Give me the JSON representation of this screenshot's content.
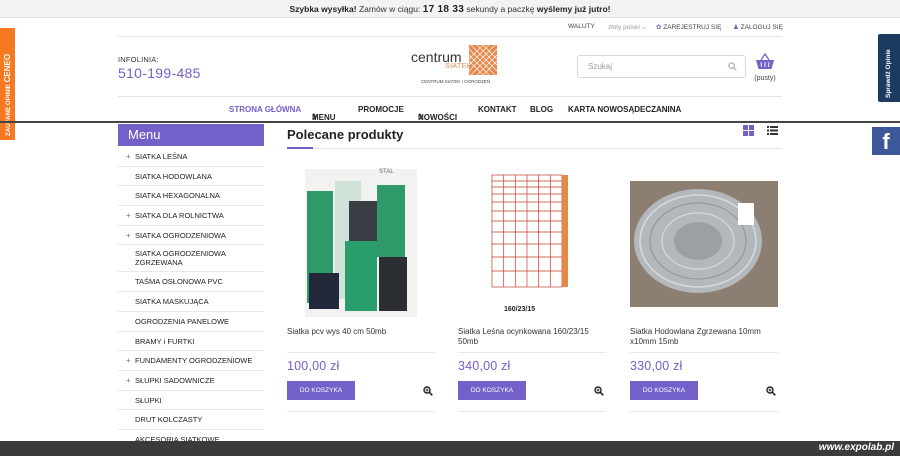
{
  "topbar": {
    "lead": "Szybka wysyłka!",
    "before": " Zamów w ciągu: ",
    "timer": "17 18 33",
    "middle": " sekundy  a paczkę ",
    "strong_end": "wyślemy już jutro!"
  },
  "account": {
    "currency": "WALUTY",
    "currency_value": "złoty polski",
    "register": "ZAREJESTRUJ SIĘ",
    "login": "ZALOGUJ SIĘ"
  },
  "side_badges": {
    "ceneo_text": "ZAUFANE OPINIE",
    "ceneo_brand": "CENEO",
    "sprawdz": "Sprawdź Opinie",
    "facebook": "f"
  },
  "header": {
    "infolinia_label": "INFOLINIA:",
    "phone": "510-199-485",
    "logo_top": "centrum",
    "logo_bottom": "SIATEK",
    "logo_tagline": "CENTRUM SIATEK I OGRODZEŃ",
    "search_placeholder": "Szukaj",
    "cart_count": "(pusty)"
  },
  "nav": {
    "items": [
      "STRONA GŁÓWNA",
      "MENU",
      "PROMOCJE",
      "NOWOŚCI",
      "KONTAKT",
      "BLOG",
      "KARTA NOWOSĄDECZANINA"
    ]
  },
  "sidebar": {
    "heading": "Menu",
    "items": [
      {
        "label": "SIATKA LEŚNA",
        "expandable": true
      },
      {
        "label": "SIATKA HODOWLANA",
        "expandable": false
      },
      {
        "label": "SIATKA HEXAGONALNA",
        "expandable": false
      },
      {
        "label": "SIATKA DLA ROLNICTWA",
        "expandable": true
      },
      {
        "label": "SIATKA OGRODZENIOWA",
        "expandable": true
      },
      {
        "label": "SIATKA OGRODZENIOWA ZGRZEWANA",
        "expandable": false
      },
      {
        "label": "TAŚMA OSŁONOWA PVC",
        "expandable": false
      },
      {
        "label": "SIATKA MASKUJĄCA",
        "expandable": false
      },
      {
        "label": "OGRODZENIA PANELOWE",
        "expandable": false
      },
      {
        "label": "BRAMY i FURTKI",
        "expandable": false
      },
      {
        "label": "FUNDAMENTY OGRODZENIOWE",
        "expandable": true
      },
      {
        "label": "SŁUPKI SADOWNICZE",
        "expandable": true
      },
      {
        "label": "SŁUPKI",
        "expandable": false
      },
      {
        "label": "DRUT KOLCZASTY",
        "expandable": false
      },
      {
        "label": "AKCESORIA SIATKOWE",
        "expandable": false
      }
    ]
  },
  "main": {
    "title": "Polecane produkty",
    "products": [
      {
        "name": "Siatka pcv wys 40 cm 50mb",
        "price": "100,00 zł",
        "button": "DO KOSZYKA",
        "image_label": "STAL"
      },
      {
        "name": "Siatka Leśna ocynkowana 160/23/15 50mb",
        "price": "340,00 zł",
        "button": "DO KOSZYKA",
        "image_label": "160/23/15"
      },
      {
        "name": "Siatka Hodowlana Zgrzewana 10mm x10mm 15mb",
        "price": "330,00 zł",
        "button": "DO KOSZYKA",
        "image_label": ""
      }
    ]
  },
  "watermark": "www.expolab.pl",
  "colors": {
    "accent": "#7460c9",
    "ceneo": "#f47920",
    "facebook": "#3b5998",
    "sprawdz": "#1d3a5f"
  }
}
